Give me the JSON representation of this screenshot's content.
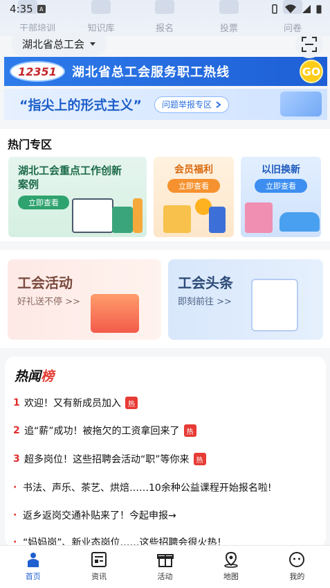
{
  "status": {
    "time": "4:35"
  },
  "top_nav": [
    "干部培训",
    "知识库",
    "报名",
    "投票",
    "问卷"
  ],
  "region": {
    "label": "湖北省总工会"
  },
  "banners": {
    "hotline_logo": "12351",
    "hotline_text": "湖北省总工会服务职工热线",
    "hotline_go": "GO",
    "formalism_text": "“指尖上的形式主义”",
    "formalism_button": "问题举报专区"
  },
  "hot_zone": {
    "title": "热门专区",
    "cards": [
      {
        "title": "湖北工会重点工作创新案例",
        "button": "立即查看"
      },
      {
        "title": "会员福利",
        "button": "立即查看"
      },
      {
        "title": "以旧换新",
        "button": "立即查看"
      }
    ]
  },
  "activities": [
    {
      "title": "工会活动",
      "subtitle": "好礼送不停 >>"
    },
    {
      "title": "工会头条",
      "subtitle": "即刻前往 >>"
    }
  ],
  "news": {
    "title_a": "热闻",
    "title_b": "榜",
    "hot_tag": "热",
    "items": [
      {
        "num": "1",
        "text": "欢迎！又有新成员加入"
      },
      {
        "num": "2",
        "text": "追“薪”成功！被拖欠的工资拿回来了"
      },
      {
        "num": "3",
        "text": "超多岗位！这些招聘会活动“职”等你来"
      },
      {
        "text": "书法、声乐、茶艺、烘焙……10余种公益课程开始报名啦!"
      },
      {
        "text": "返乡返岗交通补贴来了！今起申报→"
      },
      {
        "text": "“妈妈岗”、新业态岗位……这些招聘会很火热！"
      }
    ]
  },
  "tabbar": [
    {
      "label": "首页",
      "icon": "home-icon"
    },
    {
      "label": "资讯",
      "icon": "news-icon"
    },
    {
      "label": "活动",
      "icon": "gift-icon"
    },
    {
      "label": "地图",
      "icon": "map-pin-icon"
    },
    {
      "label": "我的",
      "icon": "profile-icon"
    }
  ],
  "colors": {
    "accent": "#1f5fd0",
    "hot": "#e73b35"
  }
}
